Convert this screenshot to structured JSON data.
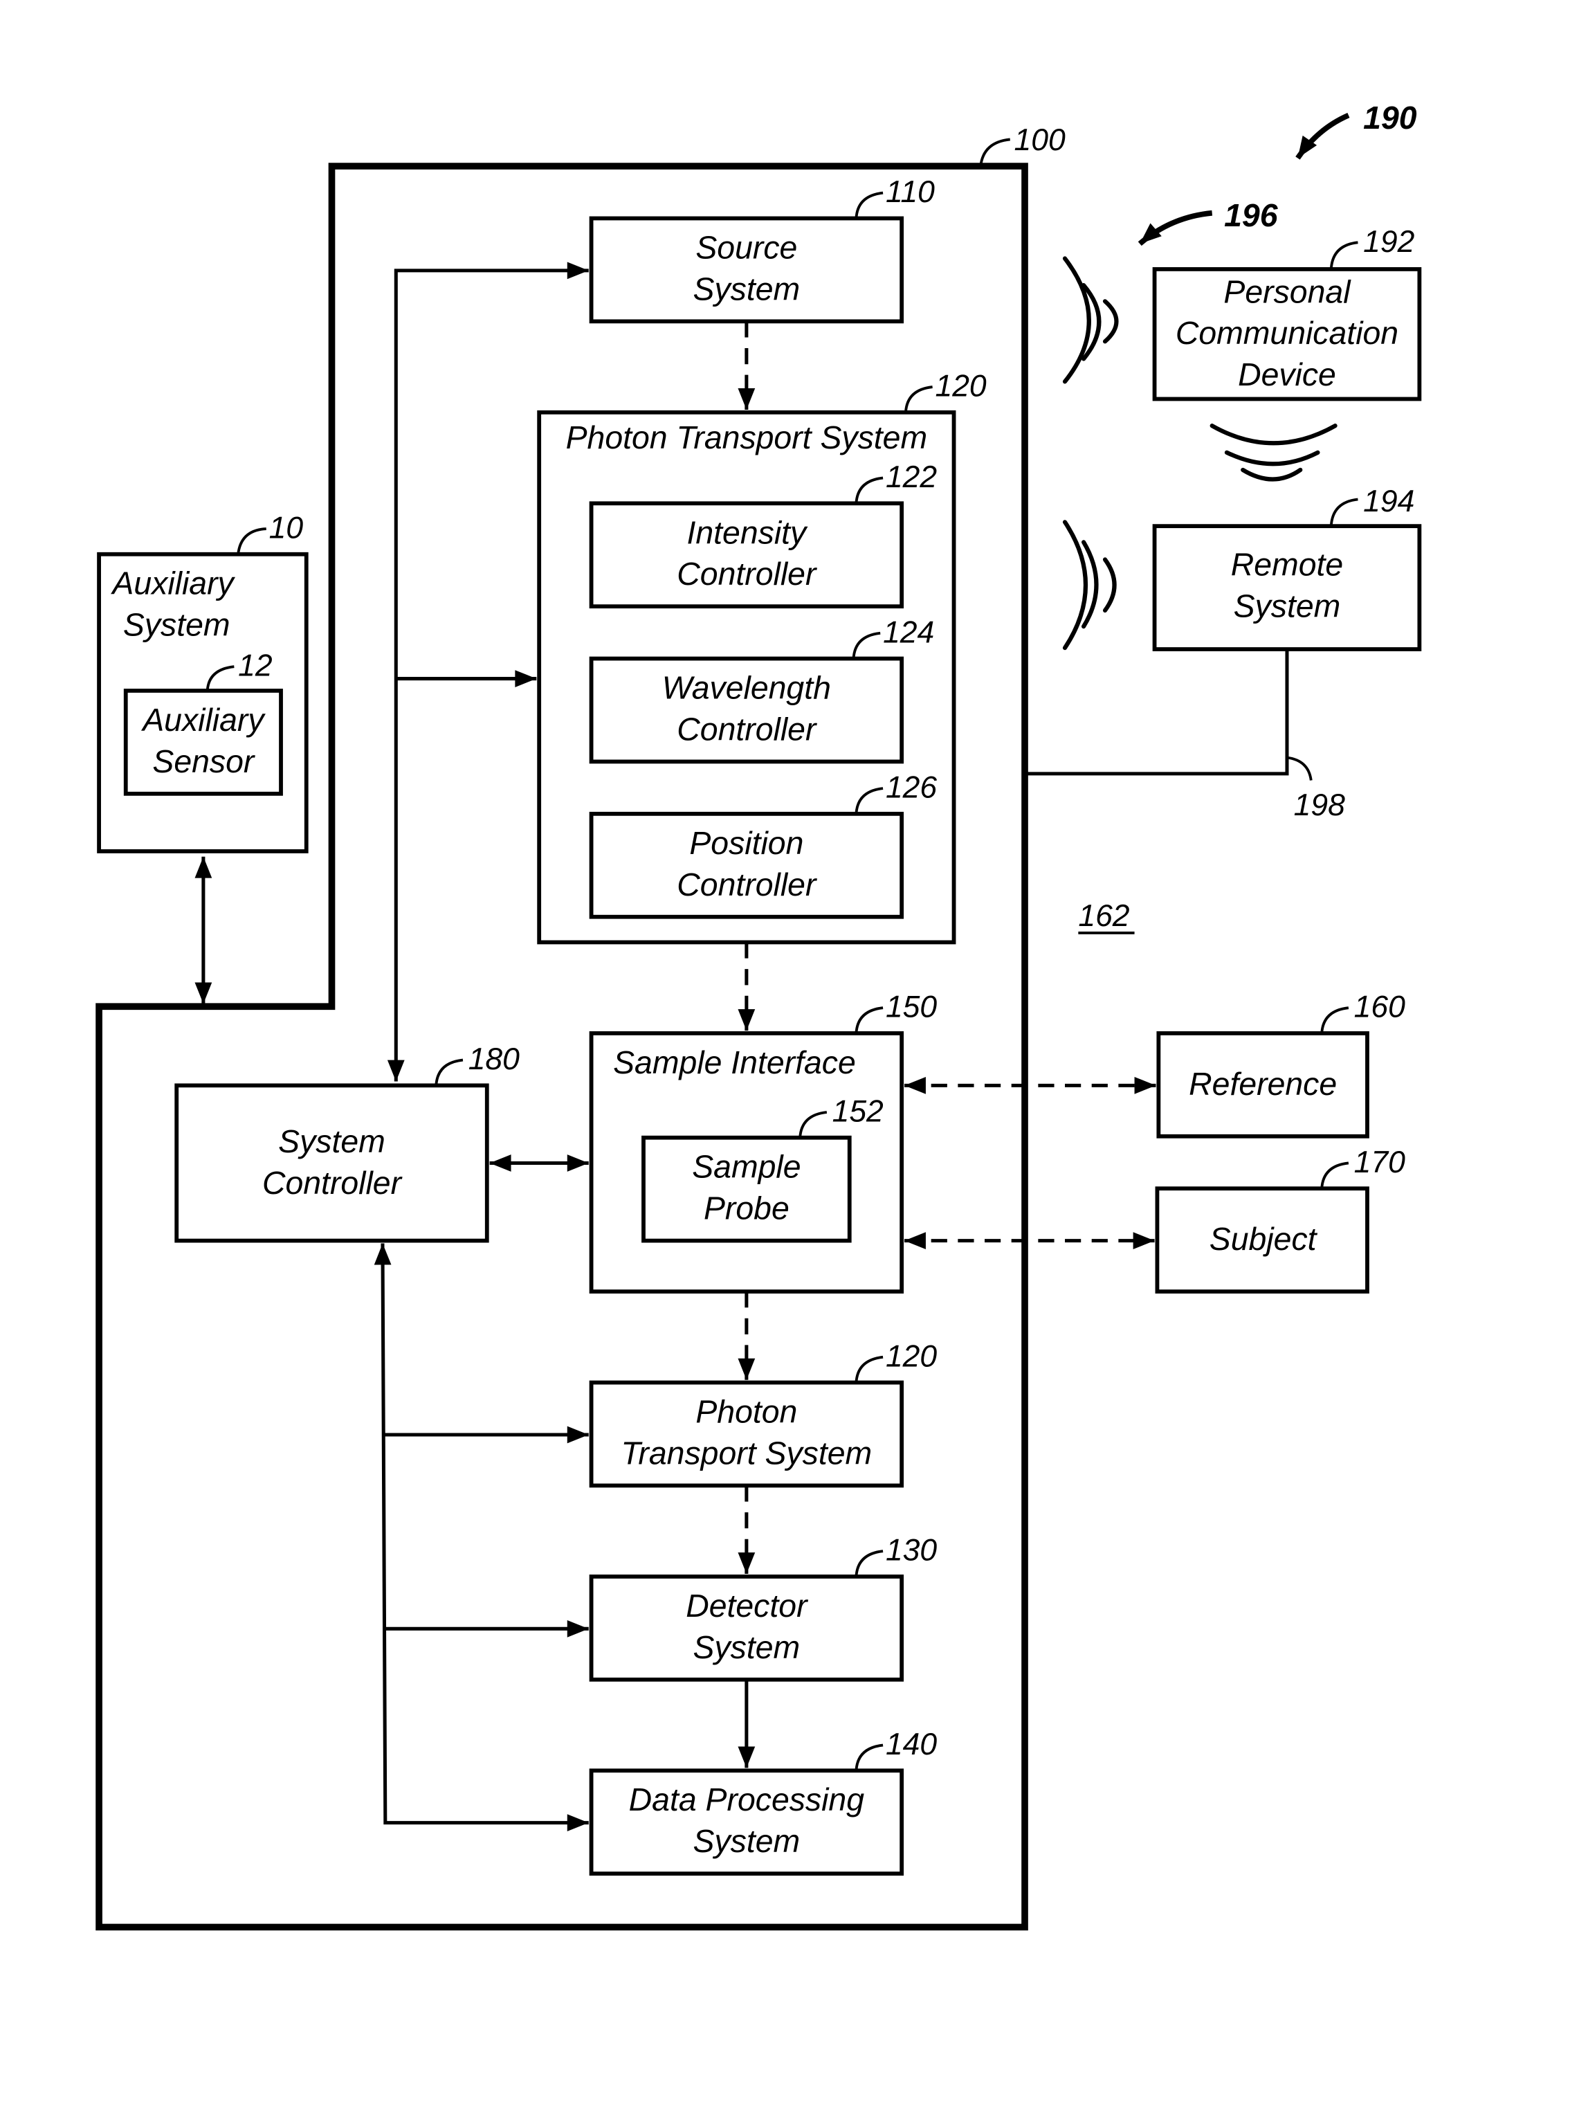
{
  "figure": {
    "boxes": {
      "auxiliary_system": {
        "label": [
          "Auxiliary",
          "System"
        ],
        "ref": "10"
      },
      "auxiliary_sensor": {
        "label": [
          "Auxiliary",
          "Sensor"
        ],
        "ref": "12"
      },
      "main_system": {
        "ref": "100"
      },
      "source_system": {
        "label": [
          "Source",
          "System"
        ],
        "ref": "110"
      },
      "photon_transport_outer": {
        "label": [
          "Photon Transport System"
        ],
        "ref": "120"
      },
      "intensity_controller": {
        "label": [
          "Intensity",
          "Controller"
        ],
        "ref": "122"
      },
      "wavelength_controller": {
        "label": [
          "Wavelength",
          "Controller"
        ],
        "ref": "124"
      },
      "position_controller": {
        "label": [
          "Position",
          "Controller"
        ],
        "ref": "126"
      },
      "sample_interface": {
        "label": [
          "Sample Interface"
        ],
        "ref": "150"
      },
      "sample_probe": {
        "label": [
          "Sample",
          "Probe"
        ],
        "ref": "152"
      },
      "system_controller": {
        "label": [
          "System",
          "Controller"
        ],
        "ref": "180"
      },
      "photon_transport_lower": {
        "label": [
          "Photon",
          "Transport System"
        ],
        "ref": "120"
      },
      "detector_system": {
        "label": [
          "Detector",
          "System"
        ],
        "ref": "130"
      },
      "data_processing_system": {
        "label": [
          "Data Processing",
          "System"
        ],
        "ref": "140"
      },
      "reference": {
        "label": [
          "Reference"
        ],
        "ref": "160"
      },
      "subject": {
        "label": [
          "Subject"
        ],
        "ref": "170"
      },
      "personal_communication_device": {
        "label": [
          "Personal",
          "Communication",
          "Device"
        ],
        "ref": "192"
      },
      "remote_system": {
        "label": [
          "Remote",
          "System"
        ],
        "ref": "194"
      }
    },
    "refs": {
      "network": "190",
      "wireless": "196",
      "wired_link": "198",
      "environment": "162"
    }
  }
}
